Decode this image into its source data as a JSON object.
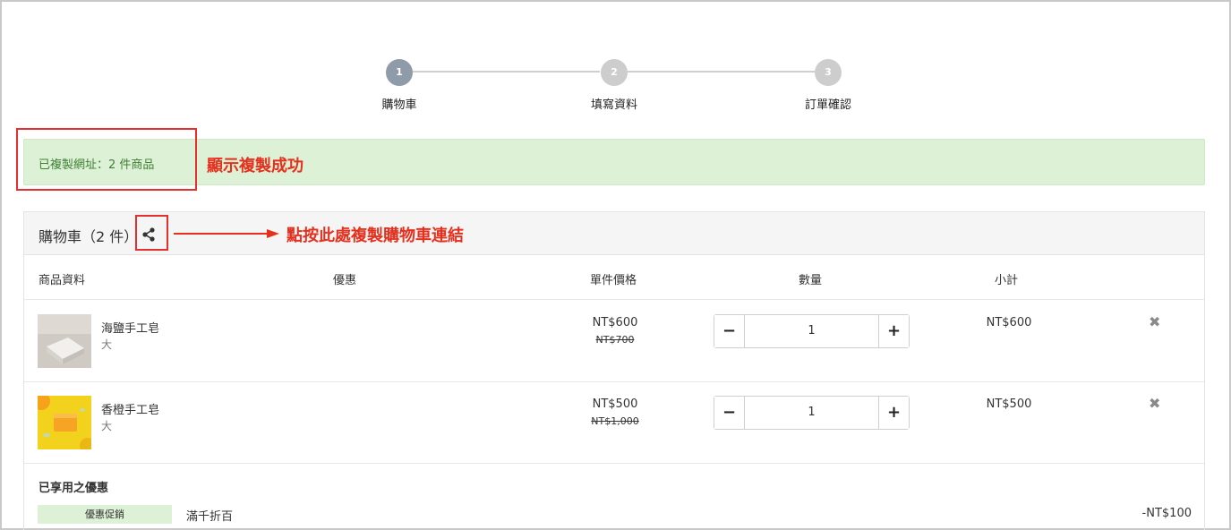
{
  "steps": [
    {
      "number": "1",
      "label": "購物車",
      "active": true
    },
    {
      "number": "2",
      "label": "填寫資料",
      "active": false
    },
    {
      "number": "3",
      "label": "訂單確認",
      "active": false
    }
  ],
  "alert": {
    "text": "已複製網址：2 件商品"
  },
  "annotations": {
    "copy_success": "顯示複製成功",
    "click_here": "點按此處複製購物車連結"
  },
  "cart": {
    "title": "購物車（2 件）",
    "share_icon": "share-icon",
    "columns": {
      "product": "商品資料",
      "discount": "優惠",
      "unit_price": "單件價格",
      "quantity": "數量",
      "subtotal": "小計"
    },
    "items": [
      {
        "name": "海鹽手工皂",
        "variant": "大",
        "price": "NT$600",
        "original_price": "NT$700",
        "quantity": "1",
        "subtotal": "NT$600",
        "minus": "−",
        "plus": "+",
        "remove": "✖"
      },
      {
        "name": "香橙手工皂",
        "variant": "大",
        "price": "NT$500",
        "original_price": "NT$1,000",
        "quantity": "1",
        "subtotal": "NT$500",
        "minus": "−",
        "plus": "+",
        "remove": "✖"
      }
    ],
    "applied_promos": {
      "title": "已享用之優惠",
      "items": [
        {
          "badge": "優惠促銷",
          "name": "滿千折百",
          "amount": "-NT$100"
        }
      ]
    }
  },
  "colors": {
    "annotation_red": "#e5301e",
    "alert_bg": "#dcf1d5",
    "alert_text": "#3f7f34"
  }
}
